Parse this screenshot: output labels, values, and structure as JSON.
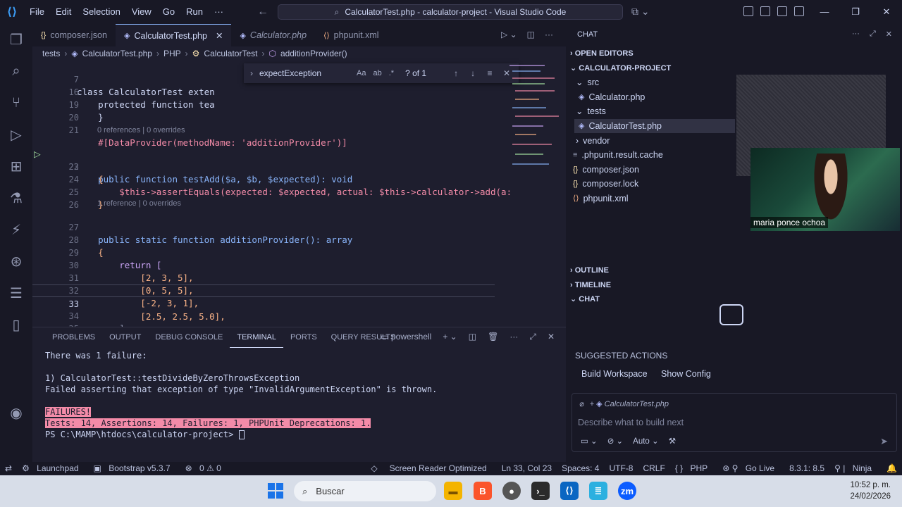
{
  "titlebar": {
    "menu": [
      "File",
      "Edit",
      "Selection",
      "View",
      "Go",
      "Run",
      "···"
    ],
    "command_center": "CalculatorTest.php - calculator-project - Visual Studio Code"
  },
  "tabs": [
    {
      "label": "composer.json",
      "icon": "json-braces-icon",
      "active": false
    },
    {
      "label": "CalculatorTest.php",
      "icon": "php-elephant-icon",
      "active": true
    },
    {
      "label": "Calculator.php",
      "icon": "php-elephant-icon",
      "active": false
    },
    {
      "label": "phpunit.xml",
      "icon": "xml-icon",
      "active": false
    }
  ],
  "breadcrumb": [
    "tests",
    "CalculatorTest.php",
    "PHP",
    "CalculatorTest",
    "additionProvider()"
  ],
  "find": {
    "term": "expectException",
    "opts": [
      "Aa",
      "ab",
      ".*"
    ],
    "count": "? of 1"
  },
  "code": {
    "lines": [
      {
        "n": "7",
        "text": "class CalculatorTest exten"
      },
      {
        "n": "16",
        "text": "    protected function tea"
      },
      {
        "n": "19",
        "text": "    }"
      },
      {
        "n": "20",
        "text": ""
      },
      {
        "n": "21",
        "text": "    #[DataProvider(methodName: 'additionProvider')]"
      },
      {
        "n": "22",
        "text": "    public function testAdd($a, $b, $expected): void"
      },
      {
        "n": "23",
        "text": "    {"
      },
      {
        "n": "24",
        "text": "        $this->assertEquals(expected: $expected, actual: $this->calculator->add(a:"
      },
      {
        "n": "25",
        "text": "    }"
      },
      {
        "n": "26",
        "text": ""
      },
      {
        "n": "27",
        "text": "    public static function additionProvider(): array"
      },
      {
        "n": "28",
        "text": "    {"
      },
      {
        "n": "29",
        "text": "        return ["
      },
      {
        "n": "30",
        "text": "            [2, 3, 5],"
      },
      {
        "n": "31",
        "text": "            [0, 5, 5],"
      },
      {
        "n": "32",
        "text": "            [-2, 3, 1],"
      },
      {
        "n": "33",
        "text": "            [2.5, 2.5, 5.0],"
      },
      {
        "n": "34",
        "text": "        ];"
      },
      {
        "n": "35",
        "text": "    }"
      }
    ],
    "lens_21": "0 references | 0 overrides",
    "lens_26": "1 reference | 0 overrides"
  },
  "panel": {
    "tabs": [
      "PROBLEMS",
      "OUTPUT",
      "DEBUG CONSOLE",
      "TERMINAL",
      "PORTS",
      "QUERY RESULTS"
    ],
    "active_tab": "TERMINAL",
    "shell": "powershell",
    "terminal": [
      "There was 1 failure:",
      "",
      "1) CalculatorTest::testDivideByZeroThrowsException",
      "Failed asserting that exception of type \"InvalidArgumentException\" is thrown.",
      "",
      "FAILURES!",
      "Tests: 14, Assertions: 14, Failures: 1, PHPUnit Deprecations: 1.",
      "PS C:\\MAMP\\htdocs\\calculator-project> "
    ]
  },
  "right": {
    "header": "CHAT",
    "open_editors": "OPEN EDITORS",
    "project": "CALCULATOR-PROJECT",
    "tree": [
      {
        "label": "src",
        "kind": "folder-open",
        "depth": 1
      },
      {
        "label": "Calculator.php",
        "kind": "php",
        "depth": 2
      },
      {
        "label": "tests",
        "kind": "folder-open",
        "depth": 1
      },
      {
        "label": "CalculatorTest.php",
        "kind": "php",
        "depth": 2,
        "selected": true
      },
      {
        "label": "vendor",
        "kind": "folder",
        "depth": 1
      },
      {
        "label": ".phpunit.result.cache",
        "kind": "file",
        "depth": 1
      },
      {
        "label": "composer.json",
        "kind": "json",
        "depth": 1
      },
      {
        "label": "composer.lock",
        "kind": "json",
        "depth": 1
      },
      {
        "label": "phpunit.xml",
        "kind": "xml",
        "depth": 1
      }
    ],
    "outline": "OUTLINE",
    "timeline": "TIMELINE",
    "chat": "CHAT",
    "webcam_name": "maria ponce ochoa",
    "suggested_title": "SUGGESTED ACTIONS",
    "suggested": [
      "Build Workspace",
      "Show Config"
    ],
    "chat_context": "CalculatorTest.php",
    "chat_placeholder": "Describe what to build next",
    "chat_mode": "Auto"
  },
  "status": {
    "launchpad": "Launchpad",
    "bootstrap": "Bootstrap v5.3.7",
    "problems": "0 ⚠ 0",
    "reader": "Screen Reader Optimized",
    "position": "Ln 33, Col 23",
    "spaces": "Spaces: 4",
    "encoding": "UTF-8",
    "eol": "CRLF",
    "lang": "PHP",
    "golive": "Go Live",
    "php_version": "8.3.1: 8.5",
    "ninja": "Ninja"
  },
  "taskbar": {
    "search": "Buscar",
    "time": "10:52 p. m.",
    "date": "24/02/2026"
  },
  "colors": {
    "accent": "#89b4fa",
    "error_bg": "#f38ba8",
    "editor_bg": "#1e1e2e",
    "sidebar_bg": "#181825"
  }
}
